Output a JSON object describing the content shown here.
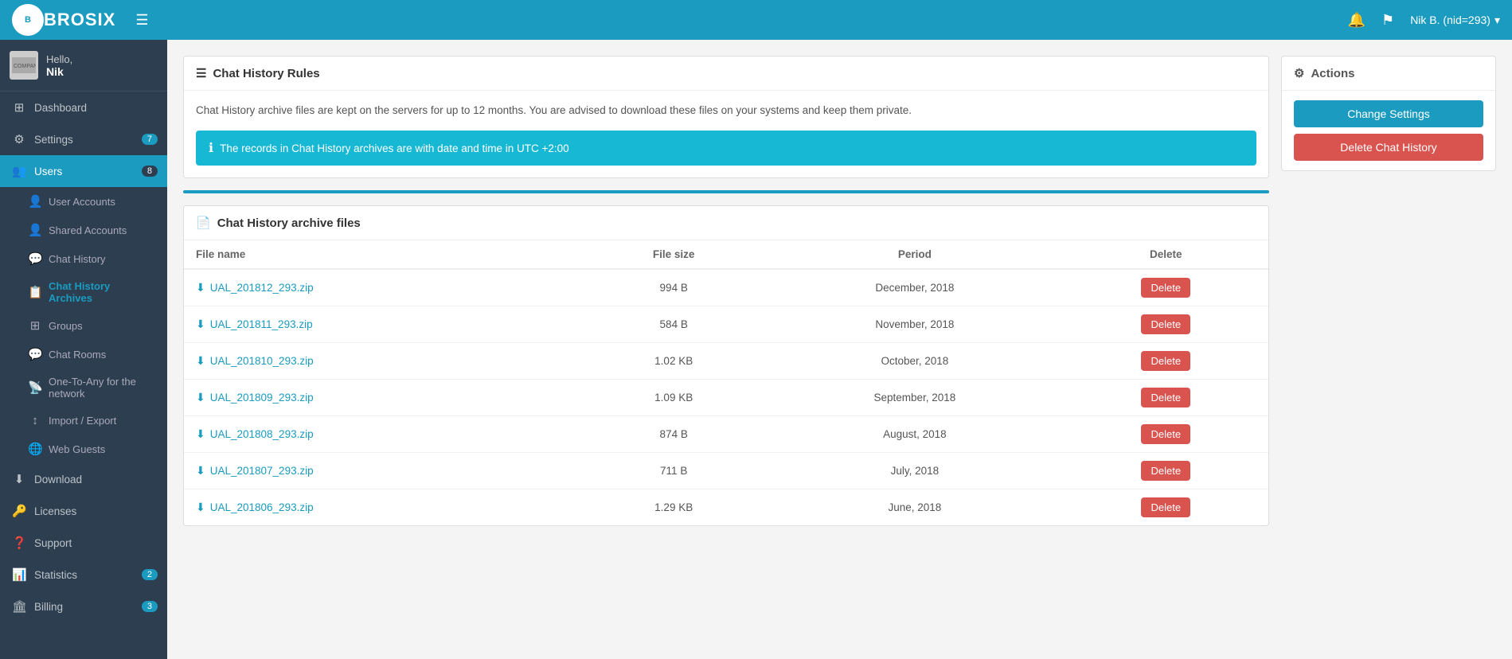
{
  "navbar": {
    "brand": "BROSIX",
    "hamburger_label": "☰",
    "user_label": "Nik B. (nid=293)",
    "bell_icon": "🔔",
    "flag_icon": "⚑",
    "caret_icon": "▾"
  },
  "sidebar": {
    "user_greeting": "Hello,",
    "username": "Nik",
    "items": [
      {
        "id": "dashboard",
        "label": "Dashboard",
        "icon": "⊞",
        "badge": null,
        "active": false
      },
      {
        "id": "settings",
        "label": "Settings",
        "icon": "⚙",
        "badge": "7",
        "active": false
      },
      {
        "id": "users",
        "label": "Users",
        "icon": "👥",
        "badge": "8",
        "active": true
      },
      {
        "id": "download",
        "label": "Download",
        "icon": "⬇",
        "badge": null,
        "active": false
      },
      {
        "id": "licenses",
        "label": "Licenses",
        "icon": "🔑",
        "badge": null,
        "active": false
      },
      {
        "id": "support",
        "label": "Support",
        "icon": "❓",
        "badge": null,
        "active": false
      },
      {
        "id": "statistics",
        "label": "Statistics",
        "icon": "📊",
        "badge": "2",
        "active": false
      },
      {
        "id": "billing",
        "label": "Billing",
        "icon": "🏛",
        "badge": "3",
        "active": false
      }
    ],
    "sub_items": [
      {
        "id": "user-accounts",
        "label": "User Accounts",
        "icon": "👤",
        "active": false
      },
      {
        "id": "shared-accounts",
        "label": "Shared Accounts",
        "icon": "👤",
        "active": false
      },
      {
        "id": "chat-history",
        "label": "Chat History",
        "icon": "💬",
        "active": false
      },
      {
        "id": "chat-history-archives",
        "label": "Chat History Archives",
        "icon": "📋",
        "active": true
      },
      {
        "id": "groups",
        "label": "Groups",
        "icon": "⊞",
        "active": false
      },
      {
        "id": "chat-rooms",
        "label": "Chat Rooms",
        "icon": "💬",
        "active": false
      },
      {
        "id": "one-to-any",
        "label": "One-To-Any for the network",
        "icon": "📡",
        "active": false
      },
      {
        "id": "import-export",
        "label": "Import / Export",
        "icon": "↕",
        "active": false
      },
      {
        "id": "web-guests",
        "label": "Web Guests",
        "icon": "🌐",
        "active": false
      }
    ]
  },
  "rules_card": {
    "header": "Chat History Rules",
    "body_text": "Chat History archive files are kept on the servers for up to 12 months. You are advised to download these files on your systems and keep them private.",
    "banner_text": "The records in Chat History archives are with date and time in UTC +2:00"
  },
  "actions_card": {
    "header": "Actions",
    "change_settings_label": "Change Settings",
    "delete_chat_history_label": "Delete Chat History"
  },
  "archive_card": {
    "header": "Chat History archive files",
    "col_filename": "File name",
    "col_filesize": "File size",
    "col_period": "Period",
    "col_delete": "Delete",
    "files": [
      {
        "name": "UAL_201812_293.zip",
        "size": "994 B",
        "period": "December, 2018"
      },
      {
        "name": "UAL_201811_293.zip",
        "size": "584 B",
        "period": "November, 2018"
      },
      {
        "name": "UAL_201810_293.zip",
        "size": "1.02 KB",
        "period": "October, 2018"
      },
      {
        "name": "UAL_201809_293.zip",
        "size": "1.09 KB",
        "period": "September, 2018"
      },
      {
        "name": "UAL_201808_293.zip",
        "size": "874 B",
        "period": "August, 2018"
      },
      {
        "name": "UAL_201807_293.zip",
        "size": "711 B",
        "period": "July, 2018"
      },
      {
        "name": "UAL_201806_293.zip",
        "size": "1.29 KB",
        "period": "June, 2018"
      }
    ],
    "delete_label": "Delete"
  }
}
